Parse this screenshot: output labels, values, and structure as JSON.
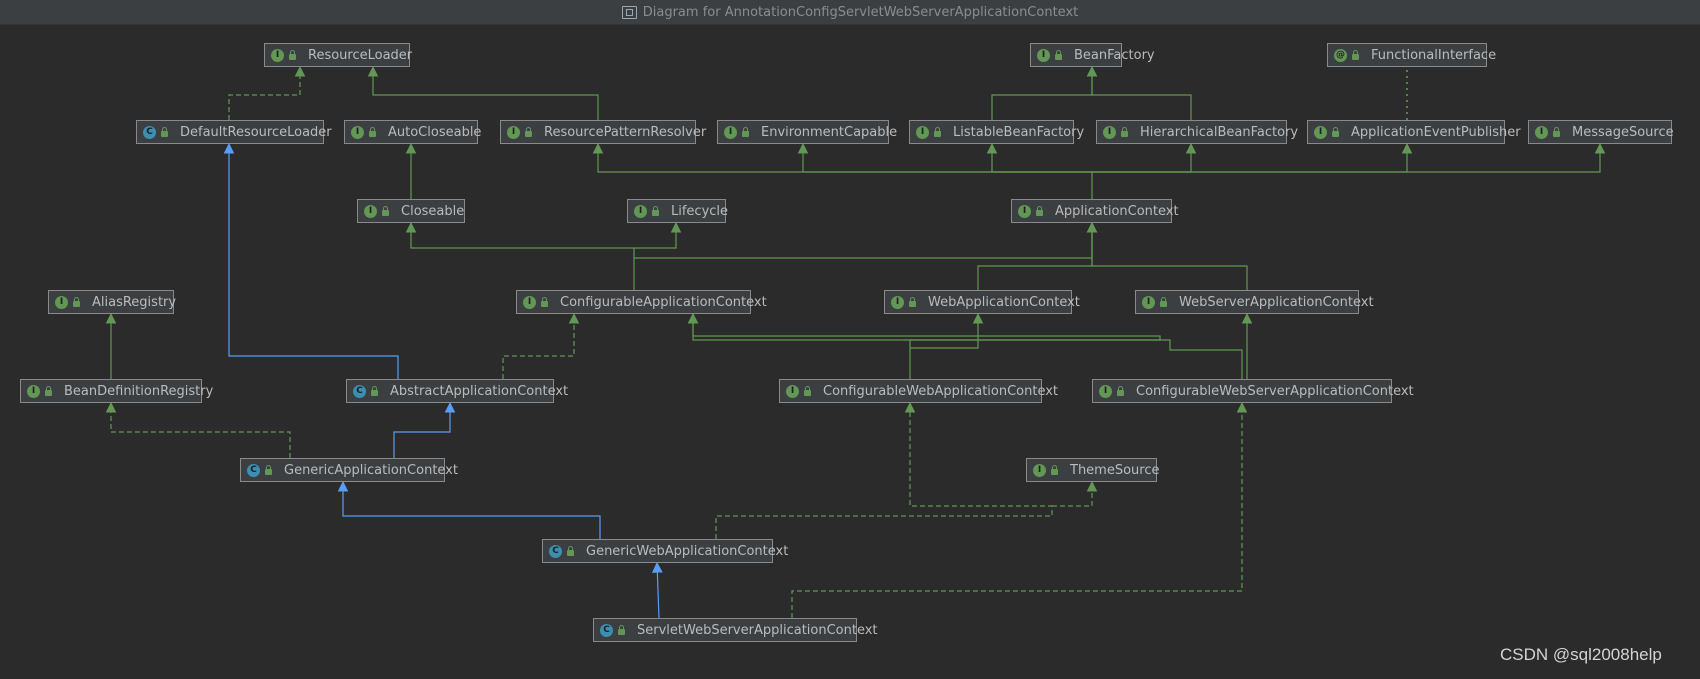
{
  "window": {
    "title": "Diagram for AnnotationConfigServletWebServerApplicationContext"
  },
  "colors": {
    "background": "#2b2b2b",
    "interface_edge": "#629755",
    "class_edge": "#589df6",
    "node_fill": "#3c3f41",
    "node_border": "#8a8a8a"
  },
  "nodes": [
    {
      "id": "ResourceLoader",
      "label": "ResourceLoader",
      "kind": "interface"
    },
    {
      "id": "BeanFactory",
      "label": "BeanFactory",
      "kind": "interface"
    },
    {
      "id": "FunctionalInterface",
      "label": "FunctionalInterface",
      "kind": "annotation"
    },
    {
      "id": "DefaultResourceLoader",
      "label": "DefaultResourceLoader",
      "kind": "class"
    },
    {
      "id": "AutoCloseable",
      "label": "AutoCloseable",
      "kind": "interface"
    },
    {
      "id": "ResourcePatternResolver",
      "label": "ResourcePatternResolver",
      "kind": "interface"
    },
    {
      "id": "EnvironmentCapable",
      "label": "EnvironmentCapable",
      "kind": "interface"
    },
    {
      "id": "ListableBeanFactory",
      "label": "ListableBeanFactory",
      "kind": "interface"
    },
    {
      "id": "HierarchicalBeanFactory",
      "label": "HierarchicalBeanFactory",
      "kind": "interface"
    },
    {
      "id": "ApplicationEventPublisher",
      "label": "ApplicationEventPublisher",
      "kind": "interface"
    },
    {
      "id": "MessageSource",
      "label": "MessageSource",
      "kind": "interface"
    },
    {
      "id": "Closeable",
      "label": "Closeable",
      "kind": "interface"
    },
    {
      "id": "Lifecycle",
      "label": "Lifecycle",
      "kind": "interface"
    },
    {
      "id": "ApplicationContext",
      "label": "ApplicationContext",
      "kind": "interface"
    },
    {
      "id": "AliasRegistry",
      "label": "AliasRegistry",
      "kind": "interface"
    },
    {
      "id": "ConfigurableApplicationContext",
      "label": "ConfigurableApplicationContext",
      "kind": "interface"
    },
    {
      "id": "WebApplicationContext",
      "label": "WebApplicationContext",
      "kind": "interface"
    },
    {
      "id": "WebServerApplicationContext",
      "label": "WebServerApplicationContext",
      "kind": "interface"
    },
    {
      "id": "BeanDefinitionRegistry",
      "label": "BeanDefinitionRegistry",
      "kind": "interface"
    },
    {
      "id": "AbstractApplicationContext",
      "label": "AbstractApplicationContext",
      "kind": "abstract"
    },
    {
      "id": "ConfigurableWebApplicationContext",
      "label": "ConfigurableWebApplicationContext",
      "kind": "interface"
    },
    {
      "id": "ConfigurableWebServerApplicationContext",
      "label": "ConfigurableWebServerApplicationContext",
      "kind": "interface"
    },
    {
      "id": "GenericApplicationContext",
      "label": "GenericApplicationContext",
      "kind": "class"
    },
    {
      "id": "ThemeSource",
      "label": "ThemeSource",
      "kind": "interface"
    },
    {
      "id": "GenericWebApplicationContext",
      "label": "GenericWebApplicationContext",
      "kind": "class"
    },
    {
      "id": "ServletWebServerApplicationContext",
      "label": "ServletWebServerApplicationContext",
      "kind": "class"
    }
  ],
  "edges": [
    {
      "from": "DefaultResourceLoader",
      "to": "ResourceLoader",
      "type": "implements"
    },
    {
      "from": "ResourcePatternResolver",
      "to": "ResourceLoader",
      "type": "extends-interface"
    },
    {
      "from": "ListableBeanFactory",
      "to": "BeanFactory",
      "type": "extends-interface"
    },
    {
      "from": "HierarchicalBeanFactory",
      "to": "BeanFactory",
      "type": "extends-interface"
    },
    {
      "from": "ApplicationEventPublisher",
      "to": "FunctionalInterface",
      "type": "annotated"
    },
    {
      "from": "Closeable",
      "to": "AutoCloseable",
      "type": "extends-interface"
    },
    {
      "from": "ApplicationContext",
      "to": "ResourcePatternResolver",
      "type": "extends-interface"
    },
    {
      "from": "ApplicationContext",
      "to": "EnvironmentCapable",
      "type": "extends-interface"
    },
    {
      "from": "ApplicationContext",
      "to": "ListableBeanFactory",
      "type": "extends-interface"
    },
    {
      "from": "ApplicationContext",
      "to": "HierarchicalBeanFactory",
      "type": "extends-interface"
    },
    {
      "from": "ApplicationContext",
      "to": "ApplicationEventPublisher",
      "type": "extends-interface"
    },
    {
      "from": "ApplicationContext",
      "to": "MessageSource",
      "type": "extends-interface"
    },
    {
      "from": "ConfigurableApplicationContext",
      "to": "Closeable",
      "type": "extends-interface"
    },
    {
      "from": "ConfigurableApplicationContext",
      "to": "Lifecycle",
      "type": "extends-interface"
    },
    {
      "from": "ConfigurableApplicationContext",
      "to": "ApplicationContext",
      "type": "extends-interface"
    },
    {
      "from": "WebApplicationContext",
      "to": "ApplicationContext",
      "type": "extends-interface"
    },
    {
      "from": "WebServerApplicationContext",
      "to": "ApplicationContext",
      "type": "extends-interface"
    },
    {
      "from": "BeanDefinitionRegistry",
      "to": "AliasRegistry",
      "type": "extends-interface"
    },
    {
      "from": "AbstractApplicationContext",
      "to": "DefaultResourceLoader",
      "type": "extends-class"
    },
    {
      "from": "AbstractApplicationContext",
      "to": "ConfigurableApplicationContext",
      "type": "implements"
    },
    {
      "from": "ConfigurableWebApplicationContext",
      "to": "WebApplicationContext",
      "type": "extends-interface"
    },
    {
      "from": "ConfigurableWebApplicationContext",
      "to": "ConfigurableApplicationContext",
      "type": "extends-interface"
    },
    {
      "from": "ConfigurableWebServerApplicationContext",
      "to": "WebServerApplicationContext",
      "type": "extends-interface"
    },
    {
      "from": "ConfigurableWebServerApplicationContext",
      "to": "ConfigurableApplicationContext",
      "type": "extends-interface"
    },
    {
      "from": "GenericApplicationContext",
      "to": "AbstractApplicationContext",
      "type": "extends-class"
    },
    {
      "from": "GenericApplicationContext",
      "to": "BeanDefinitionRegistry",
      "type": "implements"
    },
    {
      "from": "GenericWebApplicationContext",
      "to": "GenericApplicationContext",
      "type": "extends-class"
    },
    {
      "from": "GenericWebApplicationContext",
      "to": "ConfigurableWebApplicationContext",
      "type": "implements"
    },
    {
      "from": "GenericWebApplicationContext",
      "to": "ThemeSource",
      "type": "implements"
    },
    {
      "from": "ServletWebServerApplicationContext",
      "to": "GenericWebApplicationContext",
      "type": "extends-class"
    },
    {
      "from": "ServletWebServerApplicationContext",
      "to": "ConfigurableWebServerApplicationContext",
      "type": "implements"
    }
  ],
  "watermark": "CSDN @sql2008help"
}
